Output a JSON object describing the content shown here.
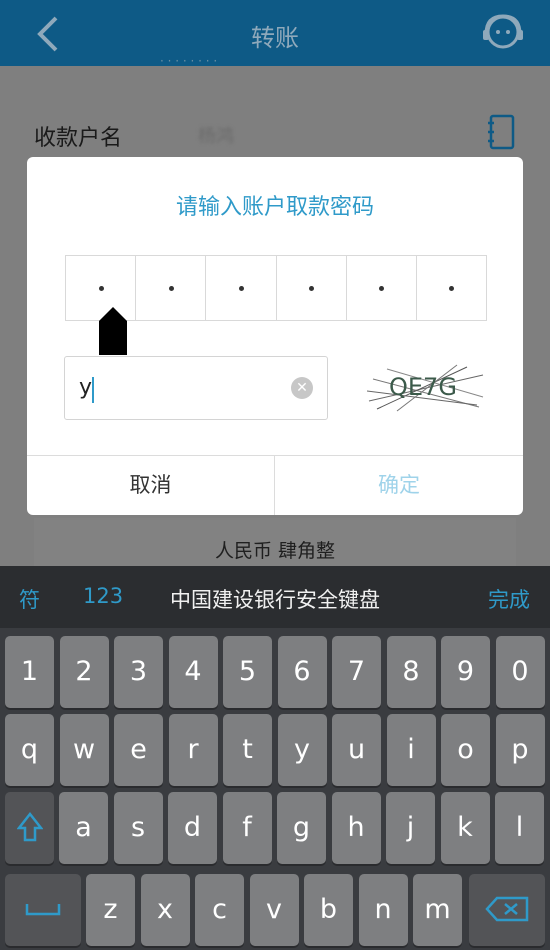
{
  "header": {
    "title": "转账",
    "subtitle_blurred": "· · · · · · · ·"
  },
  "payee": {
    "label": "收款户名",
    "value_blurred": "杨鸿"
  },
  "amount": {
    "text": "人民币  肆角整"
  },
  "dialog": {
    "title": "请输入账户取款密码",
    "pin_dots": [
      "•",
      "•",
      "•",
      "•",
      "•",
      "•"
    ],
    "captcha_input_value": "y",
    "captcha_text": "QE7G",
    "cancel_label": "取消",
    "ok_label": "确定"
  },
  "keyboard_bar": {
    "symbols_label": "符",
    "numbers_label": "123",
    "title": "中国建设银行安全键盘",
    "done_label": "完成"
  },
  "keyboard": {
    "row1": [
      "1",
      "2",
      "3",
      "4",
      "5",
      "6",
      "7",
      "8",
      "9",
      "0"
    ],
    "row2": [
      "q",
      "w",
      "e",
      "r",
      "t",
      "y",
      "u",
      "i",
      "o",
      "p"
    ],
    "row3": [
      "a",
      "s",
      "d",
      "f",
      "g",
      "h",
      "j",
      "k",
      "l"
    ],
    "row4": [
      "z",
      "x",
      "c",
      "v",
      "b",
      "n",
      "m"
    ]
  },
  "colors": {
    "accent": "#2f9ac9",
    "header_bg": "#0e5a86",
    "key_bg": "#7e7f81",
    "keyboard_bg": "#3a3c40"
  }
}
